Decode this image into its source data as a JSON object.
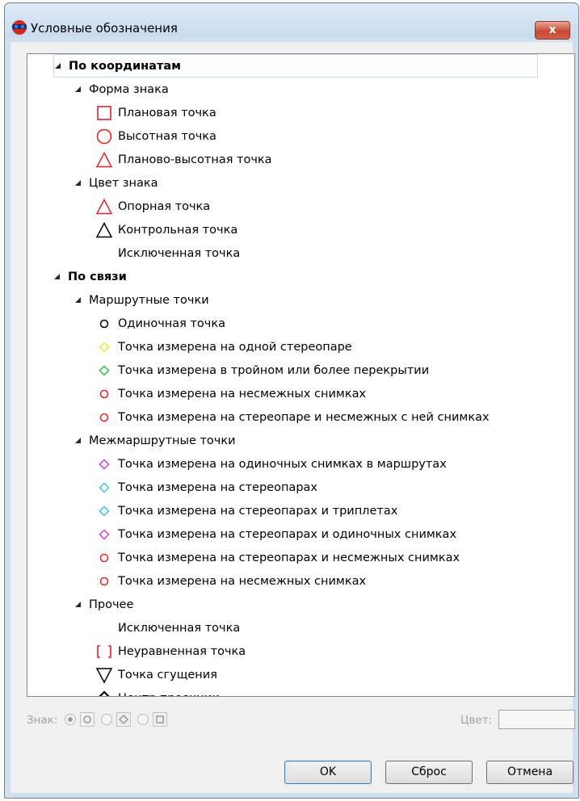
{
  "window": {
    "title": "Условные обозначения",
    "close_label": "x"
  },
  "tree": [
    {
      "label": "По координатам",
      "level": 0,
      "bold": true,
      "expanded": true,
      "symbol": "none"
    },
    {
      "label": "Форма знака",
      "level": 1,
      "expanded": true,
      "symbol": "none"
    },
    {
      "label": "Плановая точка",
      "level": 2,
      "symbol": "square",
      "color": "#e8202a"
    },
    {
      "label": "Высотная точка",
      "level": 2,
      "symbol": "circle",
      "color": "#e8202a"
    },
    {
      "label": "Планово-высотная точка",
      "level": 2,
      "symbol": "triangle",
      "color": "#e8202a"
    },
    {
      "label": "Цвет знака",
      "level": 1,
      "expanded": true,
      "symbol": "none"
    },
    {
      "label": "Опорная точка",
      "level": 2,
      "symbol": "triangle",
      "color": "#e8202a"
    },
    {
      "label": "Контрольная точка",
      "level": 2,
      "symbol": "triangle",
      "color": "#000000"
    },
    {
      "label": "Исключенная точка",
      "level": 2,
      "symbol": "none"
    },
    {
      "label": "По связи",
      "level": 0,
      "bold": true,
      "expanded": true,
      "symbol": "none"
    },
    {
      "label": "Маршрутные точки",
      "level": 1,
      "expanded": true,
      "symbol": "none"
    },
    {
      "label": "Одиночная точка",
      "level": 2,
      "symbol": "small-circle",
      "color": "#000000"
    },
    {
      "label": "Точка измерена на одной стереопаре",
      "level": 2,
      "symbol": "small-diamond",
      "color": "#f1ea2d"
    },
    {
      "label": "Точка измерена в тройном или более перекрытии",
      "level": 2,
      "symbol": "small-diamond",
      "color": "#2fbf3a"
    },
    {
      "label": "Точка измерена на несмежных снимках",
      "level": 2,
      "symbol": "small-circle",
      "color": "#e8202a"
    },
    {
      "label": "Точка измерена на стереопаре и несмежных с ней снимках",
      "level": 2,
      "symbol": "small-circle",
      "color": "#e8202a"
    },
    {
      "label": "Межмаршрутные точки",
      "level": 1,
      "expanded": true,
      "symbol": "none"
    },
    {
      "label": "Точка измерена на одиночных снимках в маршрутах",
      "level": 2,
      "symbol": "small-diamond",
      "color": "#d63ad6"
    },
    {
      "label": "Точка измерена на стереопарах",
      "level": 2,
      "symbol": "small-diamond",
      "color": "#36c6e8"
    },
    {
      "label": "Точка измерена на стереопарах и триплетах",
      "level": 2,
      "symbol": "small-diamond",
      "color": "#36c6e8"
    },
    {
      "label": "Точка измерена на стереопарах и одиночных снимках",
      "level": 2,
      "symbol": "small-diamond",
      "color": "#d63ad6"
    },
    {
      "label": "Точка измерена на стереопарах и несмежных снимках",
      "level": 2,
      "symbol": "small-circle",
      "color": "#e8202a"
    },
    {
      "label": "Точка измерена на несмежных снимках",
      "level": 2,
      "symbol": "small-circle",
      "color": "#e8202a"
    },
    {
      "label": "Прочее",
      "level": 1,
      "expanded": true,
      "symbol": "none"
    },
    {
      "label": "Исключенная точка",
      "level": 2,
      "symbol": "none"
    },
    {
      "label": "Неуравненная точка",
      "level": 2,
      "symbol": "brackets",
      "color": "#e8202a"
    },
    {
      "label": "Точка сгущения",
      "level": 2,
      "symbol": "inv-triangle",
      "color": "#000000"
    },
    {
      "label": "Центр проекции",
      "level": 2,
      "symbol": "diamond-bold",
      "color": "#000000"
    }
  ],
  "bottom": {
    "sign_label": "Знак:",
    "color_label": "Цвет:"
  },
  "buttons": {
    "ok": "OK",
    "reset": "Сброс",
    "cancel": "Отмена"
  }
}
